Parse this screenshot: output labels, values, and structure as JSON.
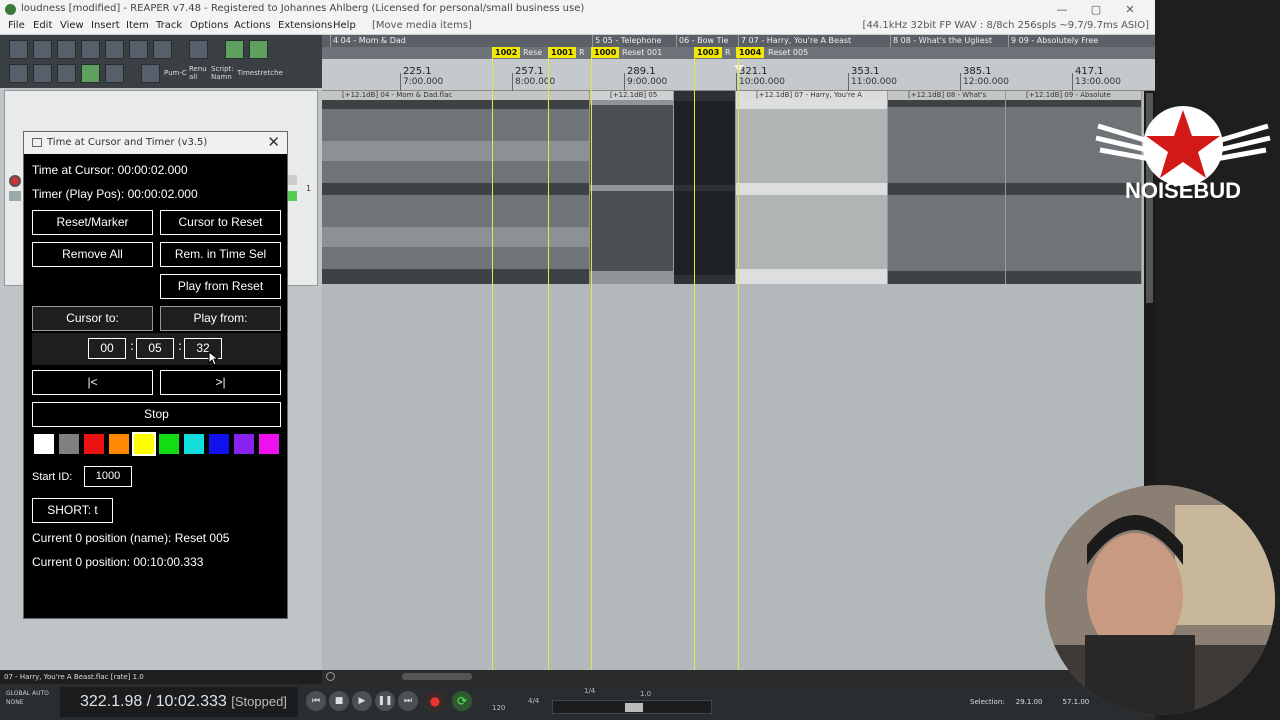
{
  "window": {
    "title": "loudness [modified] - REAPER v7.48 - Registered to Johannes Ahlberg (Licensed for personal/small business use)",
    "menu": [
      "File",
      "Edit",
      "View",
      "Insert",
      "Item",
      "Track",
      "Options",
      "Actions",
      "Extensions",
      "Help"
    ],
    "menu_hint": "[Move media items]",
    "audio_format": "[44.1kHz 32bit FP WAV : 8/8ch 256spls ~9.7/9.7ms ASIO]",
    "controls": [
      "—",
      "▢",
      "✕"
    ]
  },
  "toolbar": {
    "labels": [
      "Pum-C",
      "Renu all",
      "Script: Namn",
      "Timestretche"
    ]
  },
  "dialog": {
    "title": "Time at Cursor and Timer (v3.5)",
    "close": "✕",
    "time_at_cursor": "Time at Cursor: 00:00:02.000",
    "timer": "Timer (Play Pos): 00:00:02.000",
    "buttons": {
      "reset_marker": "Reset/Marker",
      "cursor_to_reset": "Cursor to Reset",
      "remove_all": "Remove All",
      "rem_in_time_sel": "Rem. in Time Sel",
      "play_from_reset": "Play from Reset",
      "cursor_to": "Cursor to:",
      "play_from": "Play from:",
      "prev": "|<",
      "next": ">|",
      "stop": "Stop",
      "short": "SHORT: t"
    },
    "time_fields": {
      "hh": "00",
      "mm": "05",
      "ss": "32",
      "sep": ":"
    },
    "colors": [
      "#ffffff",
      "#808080",
      "#ee1111",
      "#ff8800",
      "#ffff00",
      "#11dd11",
      "#11dddd",
      "#1111ee",
      "#8822ee",
      "#ee11ee"
    ],
    "selected_color": "#ffff00",
    "start_id_label": "Start ID:",
    "start_id_value": "1000",
    "current_name": "Current 0 position (name): Reset 005",
    "current_pos": "Current 0 position: 00:10:00.333"
  },
  "regions": [
    "4  04 - Mom & Dad",
    "5  05 - Telephone",
    "06 - Bow Tie",
    "7  07 - Harry, You're A Beast",
    "8  08 - What's the Ugliest",
    "9  09 - Absolutely Free"
  ],
  "markers": [
    {
      "id": "1002",
      "label": "Rese"
    },
    {
      "id": "1001",
      "label": "R"
    },
    {
      "id": "1000",
      "label": "Reset 001"
    },
    {
      "id": "1003",
      "label": "R"
    },
    {
      "id": "1004",
      "label": "Reset 005"
    }
  ],
  "ruler": [
    {
      "measure": "225.1",
      "time": "7:00.000"
    },
    {
      "measure": "257.1",
      "time": "8:00.000"
    },
    {
      "measure": "289.1",
      "time": "9:00.000"
    },
    {
      "measure": "321.1",
      "time": "10:00.000"
    },
    {
      "measure": "353.1",
      "time": "11:00.000"
    },
    {
      "measure": "385.1",
      "time": "12:00.000"
    },
    {
      "measure": "417.1",
      "time": "13:00.000"
    }
  ],
  "items": [
    "[+12.1dB] 04 - Mom & Dad.flac",
    "[+12.1dB] 05",
    "[+12.1dB] 07 - Harry, You're A",
    "[+12.1dB] 08 - What's",
    "[+12.1dB] 09 - Absolute"
  ],
  "track_number": "1",
  "status_line": "07 - Harry, You're A Beast.flac [rate] 1.0",
  "transport": {
    "global_auto": "GLOBAL AUTO",
    "none": "NONE",
    "position": "322.1.98 / 10:02.333",
    "state": "[Stopped]",
    "bpm": "120",
    "sig": "4/4",
    "rate_label": "1/4",
    "rate_value": "1.0",
    "selection_label": "Selection:",
    "sel_start": "29.1.00",
    "sel_end": "57.1.00"
  },
  "logo_text": "NOISEBUD"
}
